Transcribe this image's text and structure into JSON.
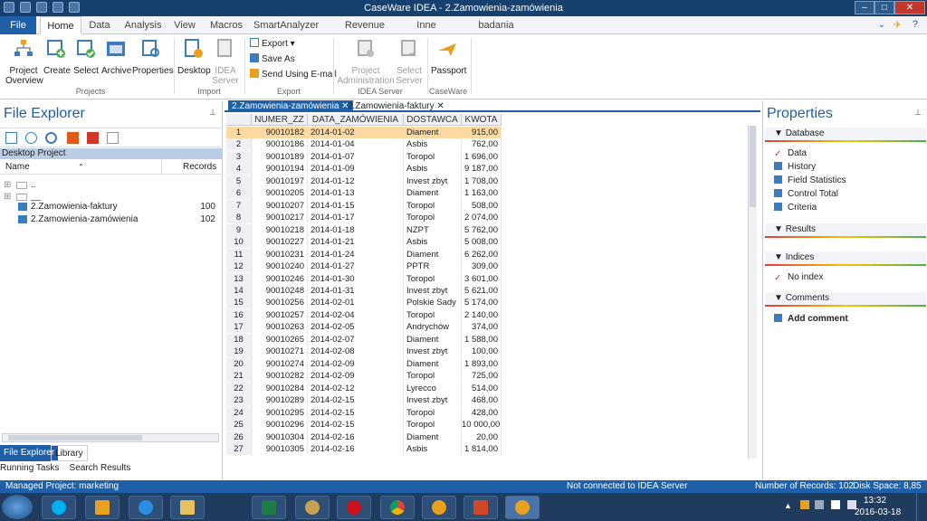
{
  "window": {
    "title": "CaseWare IDEA - 2.Zamowienia-zamówienia",
    "controls": [
      "–",
      "□",
      "✕"
    ]
  },
  "tabs": [
    "File",
    "Home",
    "Data",
    "Analysis",
    "View",
    "Macros",
    "SmartAnalyzer",
    "Revenue Assurance",
    "Inne",
    "badania automatyczne"
  ],
  "ribbon": {
    "project_overview": "Project\nOverview",
    "create": "Create",
    "select": "Select",
    "archive": "Archive",
    "properties": "Properties",
    "group_projects": "Projects",
    "desktop": "Desktop",
    "idea_server": "IDEA\nServer",
    "group_import": "Import",
    "export": "Export ▾",
    "save_as": "Save As",
    "send_email": "Send Using E-mail",
    "group_export": "Export",
    "project_admin": "Project\nAdministration",
    "select_server": "Select\nServer",
    "group_idea_server": "IDEA Server",
    "passport": "Passport",
    "group_caseware": "CaseWare"
  },
  "file_explorer": {
    "title": "File Explorer",
    "project": "Desktop Project",
    "col_name": "Name",
    "col_records": "Records",
    "items": [
      {
        "name": "..",
        "records": ""
      },
      {
        "name": "__",
        "records": ""
      },
      {
        "name": "2.Zamowienia-faktury",
        "records": "100"
      },
      {
        "name": "2.Zamowienia-zamówienia",
        "records": "102"
      }
    ],
    "bottom_tabs": [
      "File Explorer",
      "Library"
    ],
    "running_tasks": "Running Tasks",
    "search_results": "Search Results"
  },
  "doc_tabs": [
    "2.Zamowienia-zamówienia",
    "2.Zamowienia-faktury"
  ],
  "grid": {
    "headers": [
      "",
      "NUMER_ZZ",
      "DATA_ZAMÓWIENIA",
      "DOSTAWCA",
      "KWOTA"
    ],
    "rows": [
      [
        "1",
        "90010182",
        "2014-01-02",
        "Diament",
        "915,00"
      ],
      [
        "2",
        "90010186",
        "2014-01-04",
        "Asbis",
        "762,00"
      ],
      [
        "3",
        "90010189",
        "2014-01-07",
        "Toropol",
        "1 696,00"
      ],
      [
        "4",
        "90010194",
        "2014-01-09",
        "Asbis",
        "9 187,00"
      ],
      [
        "5",
        "90010197",
        "2014-01-12",
        "Invest zbyt",
        "1 708,00"
      ],
      [
        "6",
        "90010205",
        "2014-01-13",
        "Diament",
        "1 163,00"
      ],
      [
        "7",
        "90010207",
        "2014-01-15",
        "Toropol",
        "508,00"
      ],
      [
        "8",
        "90010217",
        "2014-01-17",
        "Toropol",
        "2 074,00"
      ],
      [
        "9",
        "90010218",
        "2014-01-18",
        "NZPT",
        "5 762,00"
      ],
      [
        "10",
        "90010227",
        "2014-01-21",
        "Asbis",
        "5 008,00"
      ],
      [
        "11",
        "90010231",
        "2014-01-24",
        "Diament",
        "6 262,00"
      ],
      [
        "12",
        "90010240",
        "2014-01-27",
        "PPTR",
        "309,00"
      ],
      [
        "13",
        "90010246",
        "2014-01-30",
        "Toropol",
        "3 601,00"
      ],
      [
        "14",
        "90010248",
        "2014-01-31",
        "Invest zbyt",
        "5 621,00"
      ],
      [
        "15",
        "90010256",
        "2014-02-01",
        "Polskie Sady",
        "5 174,00"
      ],
      [
        "16",
        "90010257",
        "2014-02-04",
        "Toropol",
        "2 140,00"
      ],
      [
        "17",
        "90010263",
        "2014-02-05",
        "Andrychów",
        "374,00"
      ],
      [
        "18",
        "90010265",
        "2014-02-07",
        "Diament",
        "1 588,00"
      ],
      [
        "19",
        "90010271",
        "2014-02-08",
        "Invest zbyt",
        "100,00"
      ],
      [
        "20",
        "90010274",
        "2014-02-09",
        "Diament",
        "1 893,00"
      ],
      [
        "21",
        "90010282",
        "2014-02-09",
        "Toropol",
        "725,00"
      ],
      [
        "22",
        "90010284",
        "2014-02-12",
        "Lyrecco",
        "514,00"
      ],
      [
        "23",
        "90010289",
        "2014-02-15",
        "Invest zbyt",
        "468,00"
      ],
      [
        "24",
        "90010295",
        "2014-02-15",
        "Toropol",
        "428,00"
      ],
      [
        "25",
        "90010296",
        "2014-02-15",
        "Toropol",
        "10 000,00"
      ],
      [
        "26",
        "90010304",
        "2014-02-16",
        "Diament",
        "20,00"
      ],
      [
        "27",
        "90010305",
        "2014-02-16",
        "Asbis",
        "1 814,00"
      ]
    ]
  },
  "properties": {
    "title": "Properties",
    "database": "Database",
    "db_items": [
      "Data",
      "History",
      "Field Statistics",
      "Control Total",
      "Criteria"
    ],
    "results": "Results",
    "indices": "Indices",
    "no_index": "No index",
    "comments": "Comments",
    "add_comment": "Add comment"
  },
  "status": {
    "managed": "Managed Project: marketing",
    "server": "Not connected to IDEA Server",
    "records": "Number of Records: 102",
    "disk": "Disk Space: 8,85 GB"
  },
  "taskbar": {
    "time": "13:32",
    "date": "2016-03-18"
  },
  "colors": {
    "accent": "#1f5fa8",
    "selected_row": "#fcd9a0"
  }
}
